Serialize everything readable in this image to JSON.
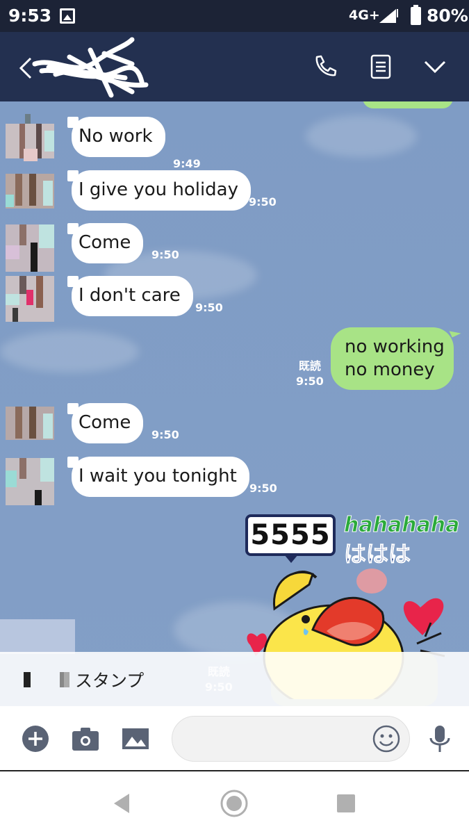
{
  "status_bar": {
    "time": "9:53",
    "network": "4G+",
    "battery": "80%"
  },
  "header": {
    "title_redacted": true
  },
  "messages": [
    {
      "text": "No work",
      "time": "9:49"
    },
    {
      "text": "I give you holiday",
      "time": "9:50"
    },
    {
      "text": "Come",
      "time": "9:50"
    },
    {
      "text": "I don't care",
      "time": "9:50"
    },
    {
      "text": "Come",
      "time": "9:50"
    },
    {
      "text": "I wait you tonight",
      "time": "9:50"
    }
  ],
  "my_message": {
    "line1": "no working",
    "line2": "no money",
    "read": "既読",
    "time": "9:50"
  },
  "sticker": {
    "bubble_text": "5555",
    "text_en": "hahahaha",
    "text_jp": "ははは"
  },
  "stamp_bar": {
    "label": "スタンプ",
    "read": "既読",
    "time": "9:50"
  },
  "colors": {
    "header": "#233050",
    "chat_bg": "#7f9cc5",
    "my_bubble": "#a8e386",
    "their_bubble": "#ffffff"
  }
}
